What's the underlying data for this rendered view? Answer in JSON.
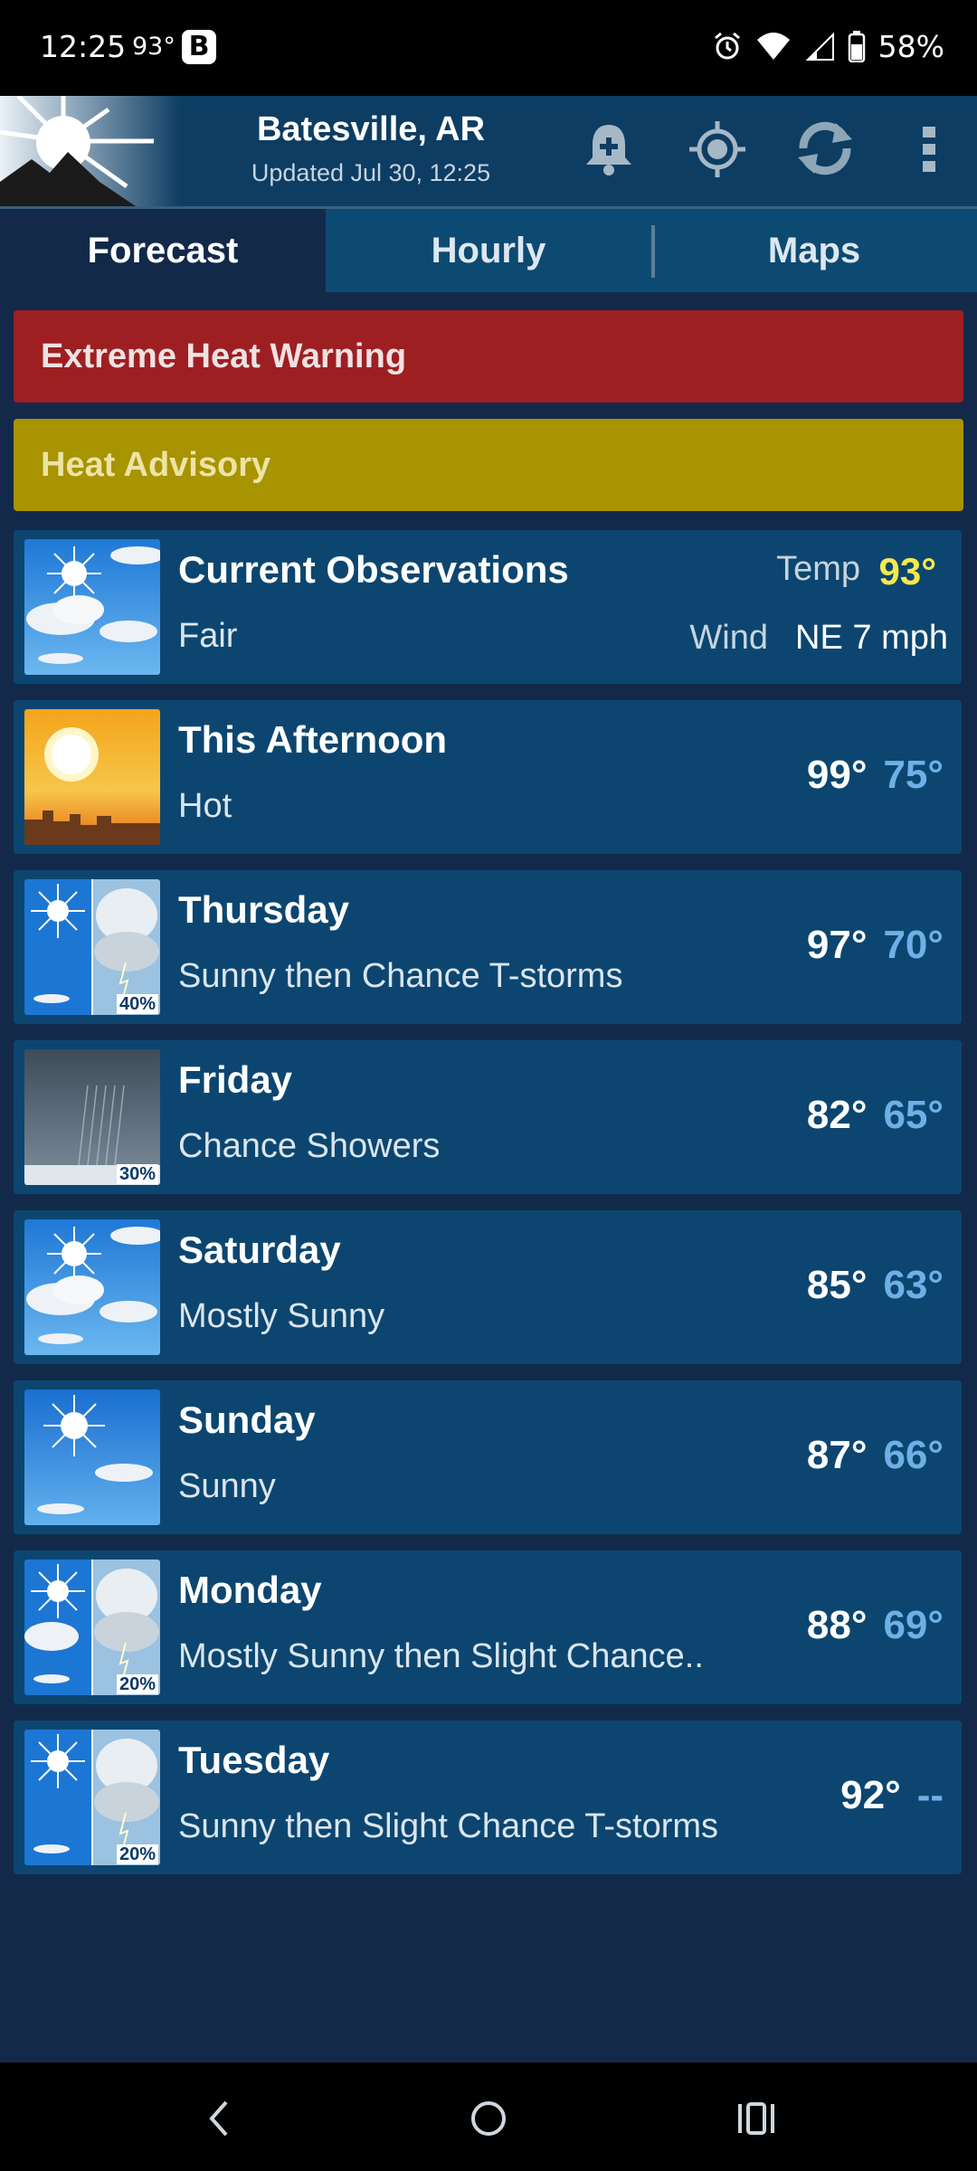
{
  "status_bar": {
    "time": "12:25",
    "temperature": "93°",
    "notification_badge": "B",
    "battery": "58%",
    "icons": [
      "alarm-icon",
      "wifi-icon",
      "signal-icon",
      "battery-icon"
    ]
  },
  "header": {
    "location": "Batesville, AR",
    "updated": "Updated Jul 30, 12:25",
    "icons": [
      "add-alert-icon",
      "location-icon",
      "refresh-icon",
      "more-icon"
    ]
  },
  "tabs": [
    {
      "label": "Forecast",
      "active": true
    },
    {
      "label": "Hourly",
      "active": false
    },
    {
      "label": "Maps",
      "active": false
    }
  ],
  "alerts": [
    {
      "label": "Extreme Heat Warning",
      "color": "#9e1f22"
    },
    {
      "label": "Heat Advisory",
      "color": "#a89300"
    }
  ],
  "current": {
    "title": "Current Observations",
    "condition": "Fair",
    "temp_label": "Temp",
    "temp_value": "93°",
    "wind_label": "Wind",
    "wind_value": "NE 7 mph"
  },
  "forecast": [
    {
      "period": "This Afternoon",
      "desc": "Hot",
      "hi": "99°",
      "lo": "75°",
      "icon": "hot-sun-icon",
      "pop": ""
    },
    {
      "period": "Thursday",
      "desc": "Sunny then Chance T-storms",
      "hi": "97°",
      "lo": "70°",
      "icon": "sunny-then-tstorm-icon",
      "pop": "40%"
    },
    {
      "period": "Friday",
      "desc": "Chance Showers",
      "hi": "82°",
      "lo": "65°",
      "icon": "showers-icon",
      "pop": "30%"
    },
    {
      "period": "Saturday",
      "desc": "Mostly Sunny",
      "hi": "85°",
      "lo": "63°",
      "icon": "mostly-sunny-icon",
      "pop": ""
    },
    {
      "period": "Sunday",
      "desc": "Sunny",
      "hi": "87°",
      "lo": "66°",
      "icon": "sunny-icon",
      "pop": ""
    },
    {
      "period": "Monday",
      "desc": "Mostly Sunny then Slight Chance..",
      "hi": "88°",
      "lo": "69°",
      "icon": "mostly-sunny-then-tstorm-icon",
      "pop": "20%"
    },
    {
      "period": "Tuesday",
      "desc": "Sunny then Slight Chance T-storms",
      "hi": "92°",
      "lo": "--",
      "icon": "sunny-then-tstorm-icon",
      "pop": "20%"
    }
  ],
  "colors": {
    "background": "#13294a",
    "row": "#0c4670",
    "low_temp": "#6eb0e6",
    "current_temp": "#f6e94e"
  }
}
